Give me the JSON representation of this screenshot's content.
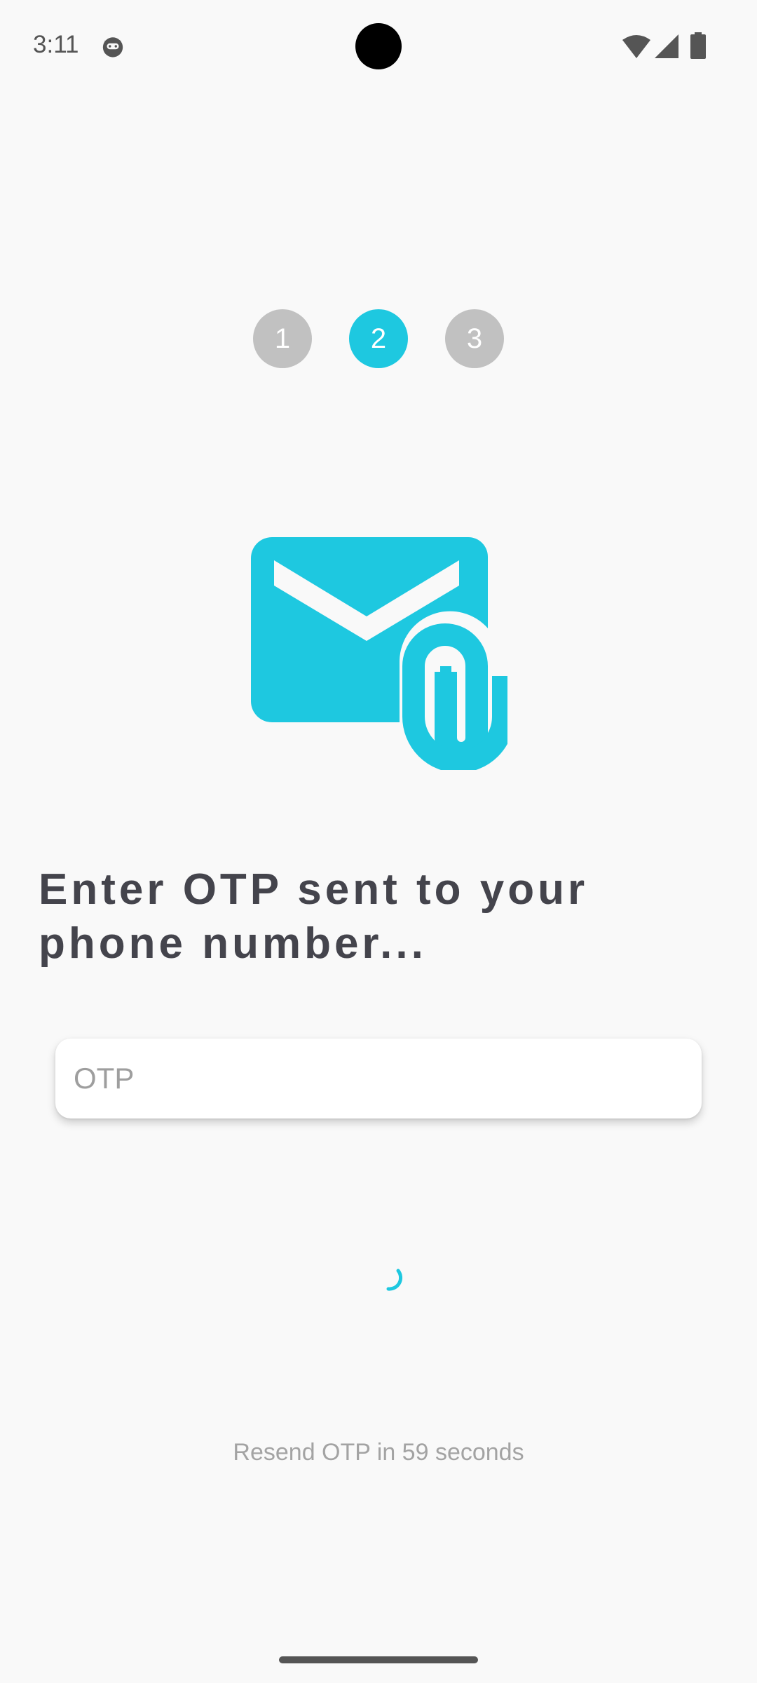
{
  "status_bar": {
    "time": "3:11",
    "app_icon": "cat-face-icon",
    "wifi_icon": "wifi-icon",
    "signal_icon": "cell-signal-icon",
    "battery_icon": "battery-icon"
  },
  "stepper": {
    "steps": [
      {
        "label": "1",
        "active": false
      },
      {
        "label": "2",
        "active": true
      },
      {
        "label": "3",
        "active": false
      }
    ],
    "current_step": 2,
    "active_color": "#1ec8e0",
    "inactive_color": "#c1c1c1"
  },
  "illustration": {
    "icon": "mail-attachment-icon",
    "color": "#1ec8e0"
  },
  "heading": "Enter OTP sent to your phone number...",
  "otp": {
    "placeholder": "OTP",
    "value": ""
  },
  "loading": {
    "icon": "loading-spinner-icon",
    "color": "#1ec8e0"
  },
  "resend": {
    "text": "Resend OTP in 59 seconds"
  },
  "colors": {
    "accent": "#1ec8e0",
    "background": "#f9f9f9",
    "heading": "#44444c"
  }
}
